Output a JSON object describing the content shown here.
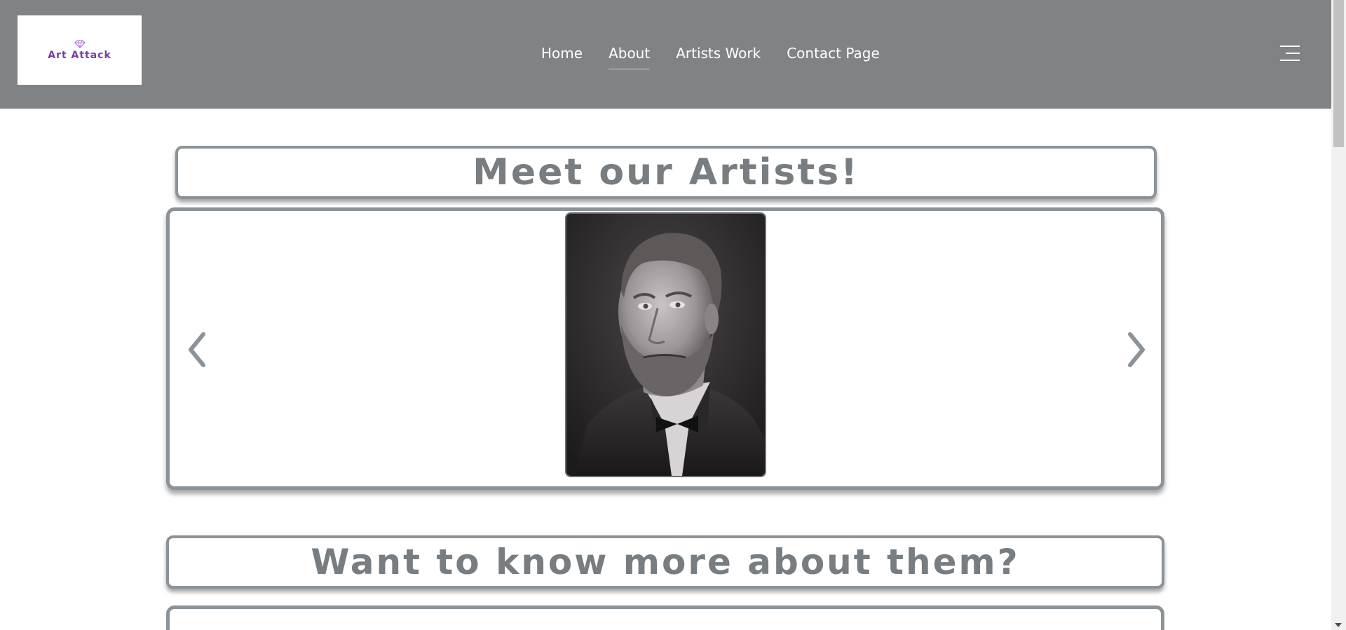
{
  "header": {
    "logo": {
      "text": "Art Attack",
      "icon": "diamond-heart-icon",
      "color": "#7a3aa8"
    },
    "nav": [
      {
        "label": "Home",
        "active": false
      },
      {
        "label": "About",
        "active": true
      },
      {
        "label": "Artists Work",
        "active": false
      },
      {
        "label": "Contact Page",
        "active": false
      }
    ],
    "menu_icon": "hamburger-menu-icon",
    "background": "#808386"
  },
  "main": {
    "artists_title": "Meet our Artists!",
    "carousel": {
      "prev_icon": "chevron-left-icon",
      "next_icon": "chevron-right-icon",
      "current_image": "artist-portrait"
    },
    "more_title": "Want to know more about them?"
  },
  "colors": {
    "border": "#8c9398",
    "title_text": "#777d80"
  }
}
